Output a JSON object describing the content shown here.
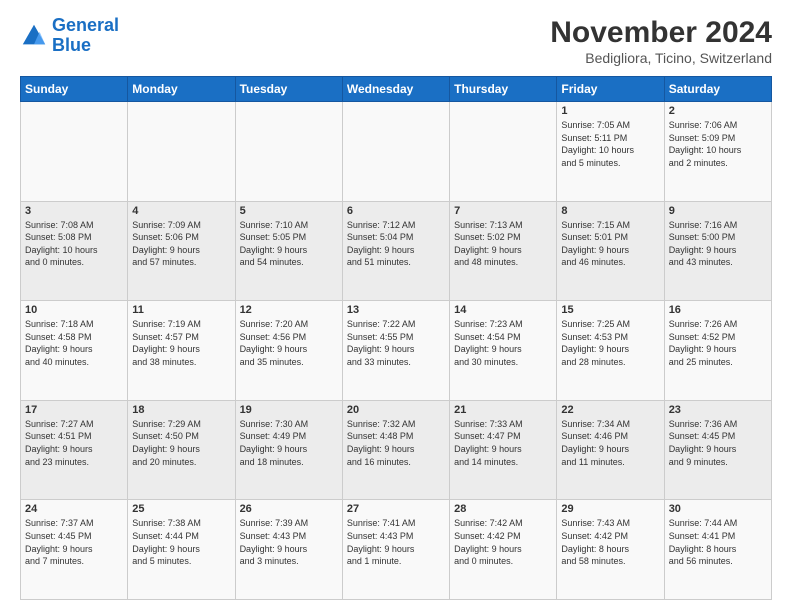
{
  "header": {
    "logo_line1": "General",
    "logo_line2": "Blue",
    "title": "November 2024",
    "subtitle": "Bedigliora, Ticino, Switzerland"
  },
  "columns": [
    "Sunday",
    "Monday",
    "Tuesday",
    "Wednesday",
    "Thursday",
    "Friday",
    "Saturday"
  ],
  "weeks": [
    [
      {
        "day": "",
        "info": ""
      },
      {
        "day": "",
        "info": ""
      },
      {
        "day": "",
        "info": ""
      },
      {
        "day": "",
        "info": ""
      },
      {
        "day": "",
        "info": ""
      },
      {
        "day": "1",
        "info": "Sunrise: 7:05 AM\nSunset: 5:11 PM\nDaylight: 10 hours\nand 5 minutes."
      },
      {
        "day": "2",
        "info": "Sunrise: 7:06 AM\nSunset: 5:09 PM\nDaylight: 10 hours\nand 2 minutes."
      }
    ],
    [
      {
        "day": "3",
        "info": "Sunrise: 7:08 AM\nSunset: 5:08 PM\nDaylight: 10 hours\nand 0 minutes."
      },
      {
        "day": "4",
        "info": "Sunrise: 7:09 AM\nSunset: 5:06 PM\nDaylight: 9 hours\nand 57 minutes."
      },
      {
        "day": "5",
        "info": "Sunrise: 7:10 AM\nSunset: 5:05 PM\nDaylight: 9 hours\nand 54 minutes."
      },
      {
        "day": "6",
        "info": "Sunrise: 7:12 AM\nSunset: 5:04 PM\nDaylight: 9 hours\nand 51 minutes."
      },
      {
        "day": "7",
        "info": "Sunrise: 7:13 AM\nSunset: 5:02 PM\nDaylight: 9 hours\nand 48 minutes."
      },
      {
        "day": "8",
        "info": "Sunrise: 7:15 AM\nSunset: 5:01 PM\nDaylight: 9 hours\nand 46 minutes."
      },
      {
        "day": "9",
        "info": "Sunrise: 7:16 AM\nSunset: 5:00 PM\nDaylight: 9 hours\nand 43 minutes."
      }
    ],
    [
      {
        "day": "10",
        "info": "Sunrise: 7:18 AM\nSunset: 4:58 PM\nDaylight: 9 hours\nand 40 minutes."
      },
      {
        "day": "11",
        "info": "Sunrise: 7:19 AM\nSunset: 4:57 PM\nDaylight: 9 hours\nand 38 minutes."
      },
      {
        "day": "12",
        "info": "Sunrise: 7:20 AM\nSunset: 4:56 PM\nDaylight: 9 hours\nand 35 minutes."
      },
      {
        "day": "13",
        "info": "Sunrise: 7:22 AM\nSunset: 4:55 PM\nDaylight: 9 hours\nand 33 minutes."
      },
      {
        "day": "14",
        "info": "Sunrise: 7:23 AM\nSunset: 4:54 PM\nDaylight: 9 hours\nand 30 minutes."
      },
      {
        "day": "15",
        "info": "Sunrise: 7:25 AM\nSunset: 4:53 PM\nDaylight: 9 hours\nand 28 minutes."
      },
      {
        "day": "16",
        "info": "Sunrise: 7:26 AM\nSunset: 4:52 PM\nDaylight: 9 hours\nand 25 minutes."
      }
    ],
    [
      {
        "day": "17",
        "info": "Sunrise: 7:27 AM\nSunset: 4:51 PM\nDaylight: 9 hours\nand 23 minutes."
      },
      {
        "day": "18",
        "info": "Sunrise: 7:29 AM\nSunset: 4:50 PM\nDaylight: 9 hours\nand 20 minutes."
      },
      {
        "day": "19",
        "info": "Sunrise: 7:30 AM\nSunset: 4:49 PM\nDaylight: 9 hours\nand 18 minutes."
      },
      {
        "day": "20",
        "info": "Sunrise: 7:32 AM\nSunset: 4:48 PM\nDaylight: 9 hours\nand 16 minutes."
      },
      {
        "day": "21",
        "info": "Sunrise: 7:33 AM\nSunset: 4:47 PM\nDaylight: 9 hours\nand 14 minutes."
      },
      {
        "day": "22",
        "info": "Sunrise: 7:34 AM\nSunset: 4:46 PM\nDaylight: 9 hours\nand 11 minutes."
      },
      {
        "day": "23",
        "info": "Sunrise: 7:36 AM\nSunset: 4:45 PM\nDaylight: 9 hours\nand 9 minutes."
      }
    ],
    [
      {
        "day": "24",
        "info": "Sunrise: 7:37 AM\nSunset: 4:45 PM\nDaylight: 9 hours\nand 7 minutes."
      },
      {
        "day": "25",
        "info": "Sunrise: 7:38 AM\nSunset: 4:44 PM\nDaylight: 9 hours\nand 5 minutes."
      },
      {
        "day": "26",
        "info": "Sunrise: 7:39 AM\nSunset: 4:43 PM\nDaylight: 9 hours\nand 3 minutes."
      },
      {
        "day": "27",
        "info": "Sunrise: 7:41 AM\nSunset: 4:43 PM\nDaylight: 9 hours\nand 1 minute."
      },
      {
        "day": "28",
        "info": "Sunrise: 7:42 AM\nSunset: 4:42 PM\nDaylight: 9 hours\nand 0 minutes."
      },
      {
        "day": "29",
        "info": "Sunrise: 7:43 AM\nSunset: 4:42 PM\nDaylight: 8 hours\nand 58 minutes."
      },
      {
        "day": "30",
        "info": "Sunrise: 7:44 AM\nSunset: 4:41 PM\nDaylight: 8 hours\nand 56 minutes."
      }
    ]
  ]
}
